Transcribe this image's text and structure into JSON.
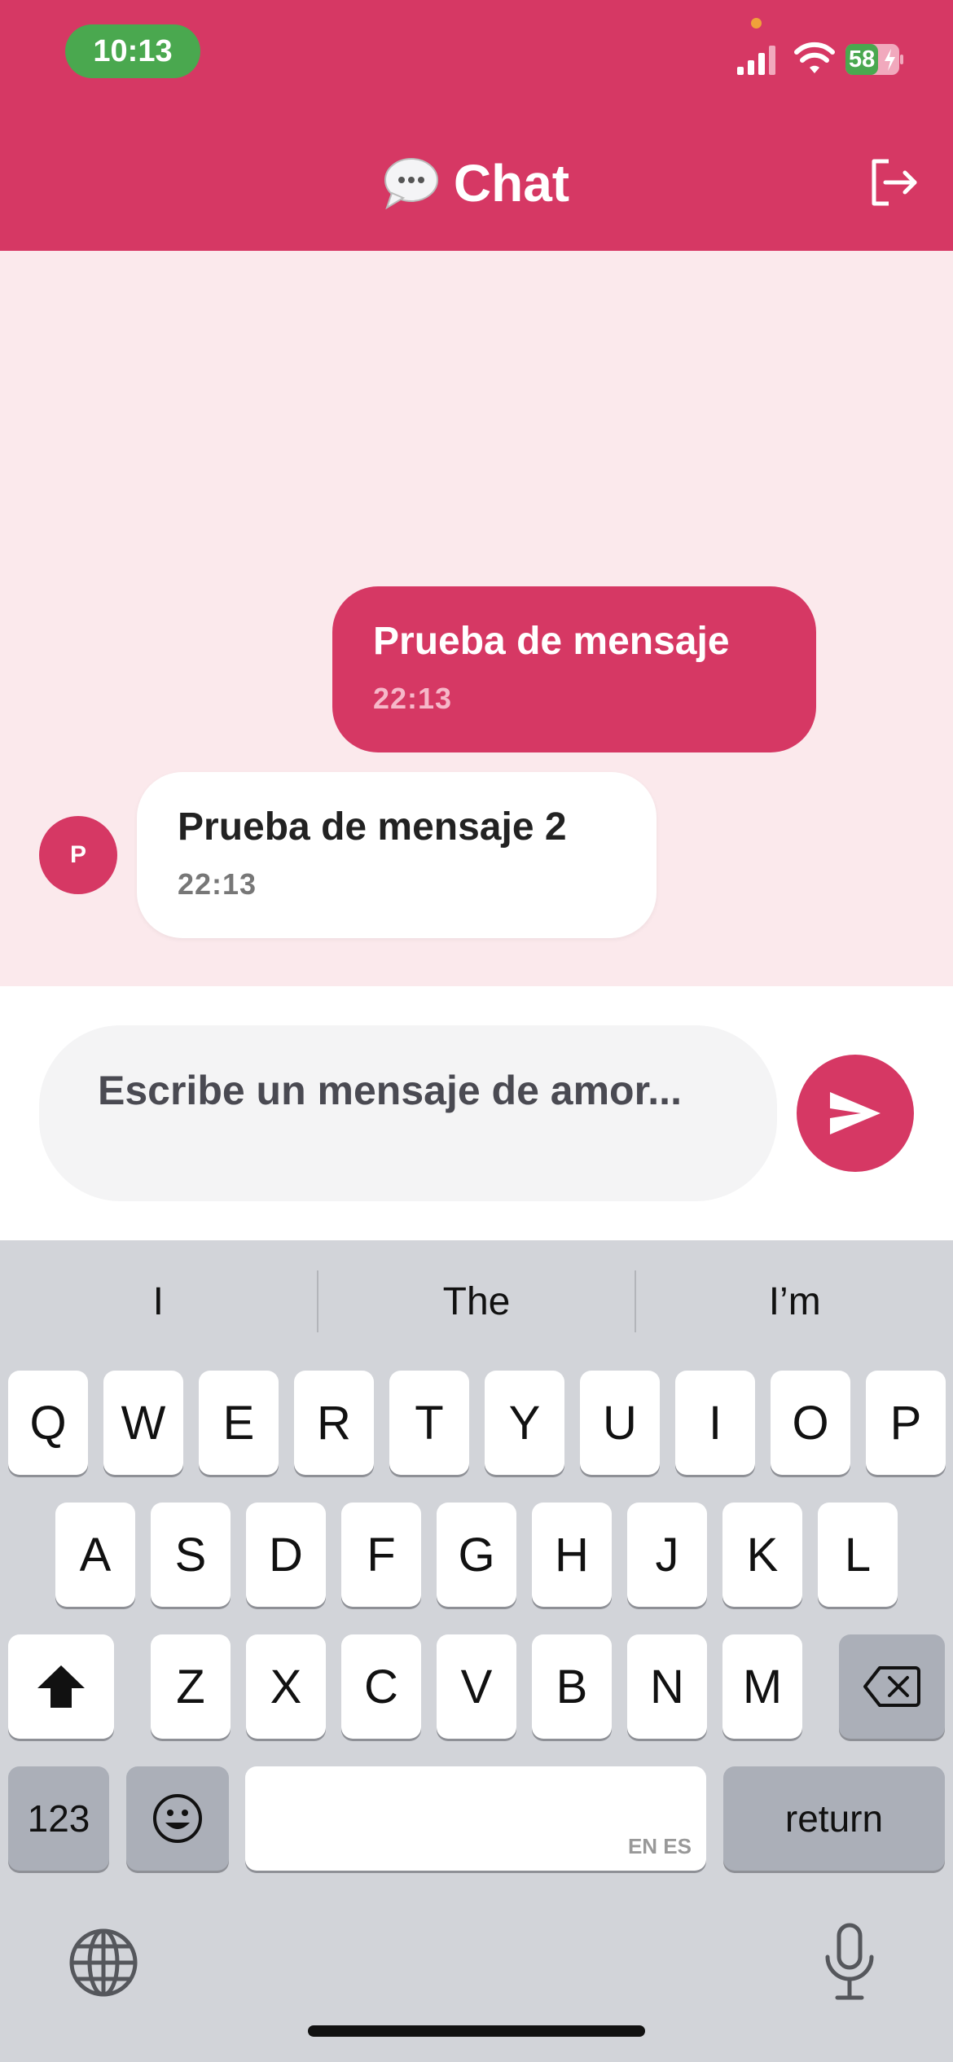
{
  "status_bar": {
    "time": "10:13",
    "battery": "58"
  },
  "header": {
    "title": "Chat"
  },
  "messages": [
    {
      "direction": "outgoing",
      "text": "Prueba de mensaje",
      "time": "22:13"
    },
    {
      "direction": "incoming",
      "avatar_initial": "P",
      "text": "Prueba de mensaje 2",
      "time": "22:13"
    }
  ],
  "composer": {
    "placeholder": "Escribe un mensaje de amor..."
  },
  "keyboard": {
    "suggestions": [
      "I",
      "The",
      "I’m"
    ],
    "row1": [
      "Q",
      "W",
      "E",
      "R",
      "T",
      "Y",
      "U",
      "I",
      "O",
      "P"
    ],
    "row2": [
      "A",
      "S",
      "D",
      "F",
      "G",
      "H",
      "J",
      "K",
      "L"
    ],
    "row3": [
      "Z",
      "X",
      "C",
      "V",
      "B",
      "N",
      "M"
    ],
    "numbers_label": "123",
    "return_label": "return",
    "space_languages": "EN ES"
  },
  "colors": {
    "accent": "#d63864",
    "chat_background": "#fbe9ec",
    "status_green": "#4aa84f"
  },
  "icons": [
    "chat-bubble-icon",
    "logout-icon",
    "send-icon",
    "shift-icon",
    "backspace-icon",
    "emoji-icon",
    "globe-icon",
    "microphone-icon",
    "signal-icon",
    "wifi-icon",
    "battery-icon"
  ]
}
